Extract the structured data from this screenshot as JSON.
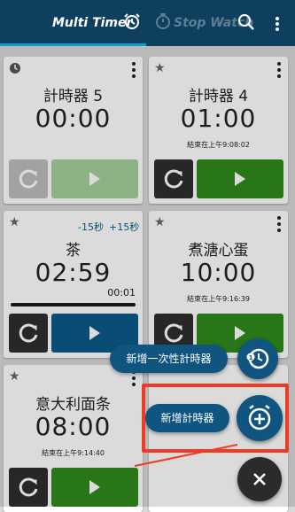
{
  "header": {
    "tab_multi_timer": "Multi Timer",
    "tab_stop_watch": "Stop Watch"
  },
  "timers": [
    {
      "name": "計時器 5",
      "time": "00:00",
      "end": ""
    },
    {
      "name": "計時器 4",
      "time": "01:00",
      "end": "結束在上午9:08:02"
    },
    {
      "name": "茶",
      "time": "02:59",
      "end": "",
      "sub_time": "00:01",
      "minus": "-15秒",
      "plus": "+15秒"
    },
    {
      "name": "煮溏心蛋",
      "time": "10:00",
      "end": "結束在上午9:16:39"
    },
    {
      "name": "意大利面条",
      "time": "08:00",
      "end": "結束在上午9:14:40"
    }
  ],
  "fab_menu": {
    "add_one_time_label": "新增一次性計時器",
    "add_timer_label": "新增計時器"
  },
  "colors": {
    "header": "#0f3f5f",
    "accent": "#0aa2c7",
    "green_play": "#2f8a1d",
    "blue_play": "#0b5a8a",
    "highlight": "#ee3b24"
  }
}
